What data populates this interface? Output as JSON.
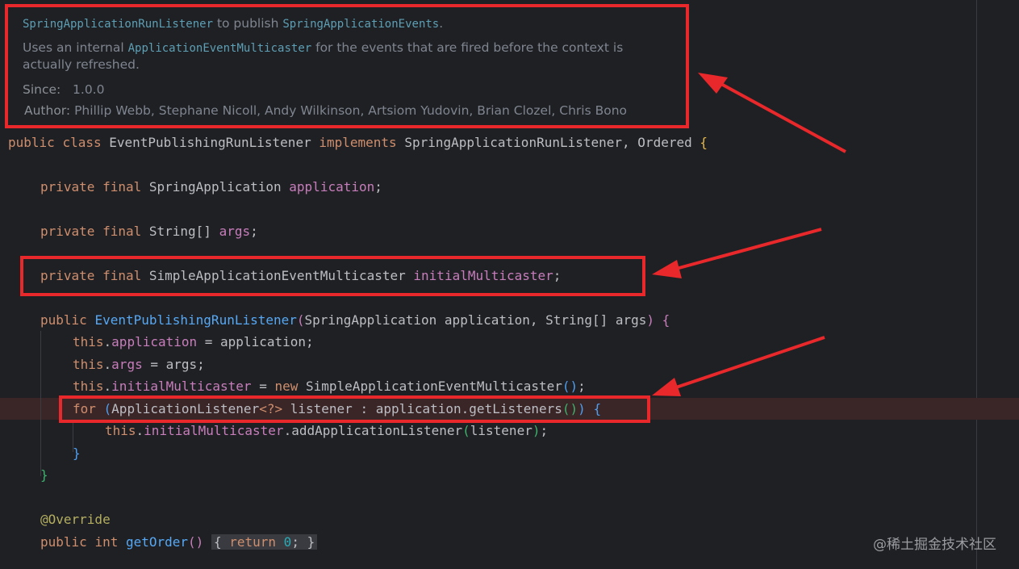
{
  "javadoc": {
    "line1": {
      "class_name": "SpringApplicationRunListener",
      "middle": " to publish ",
      "events": "SpringApplicationEvents",
      "end": "."
    },
    "line2": {
      "start": "Uses an internal ",
      "multicaster": "ApplicationEventMulticaster",
      "end": " for the events that are fired before the context is"
    },
    "line3": "actually refreshed.",
    "since_label": "Since:",
    "since_value": "1.0.0",
    "author_label": "Author:",
    "author_value": "Phillip Webb, Stephane Nicoll, Andy Wilkinson, Artsiom Yudovin, Brian Clozel, Chris Bono"
  },
  "code": {
    "class_decl": {
      "public": "public",
      "class": "class",
      "name": "EventPublishingRunListener",
      "implements": "implements",
      "iface": "SpringApplicationRunListener, Ordered",
      "brace": "{"
    },
    "field1": {
      "mods": "private final",
      "type": "SpringApplication",
      "name": "application",
      "semi": ";"
    },
    "field2": {
      "mods": "private final",
      "type": "String[]",
      "name": "args",
      "semi": ";"
    },
    "field3": {
      "mods": "private final",
      "type": "SimpleApplicationEventMulticaster",
      "name": "initialMulticaster",
      "semi": ";"
    },
    "ctor": {
      "public": "public",
      "name": "EventPublishingRunListener",
      "open": "(",
      "params": "SpringApplication application, String[] args",
      "close": ")",
      "brace": "{"
    },
    "stmt1": {
      "this": "this",
      "dot": ".",
      "field": "application",
      "rest": " = application;"
    },
    "stmt2": {
      "this": "this",
      "dot": ".",
      "field": "args",
      "rest": " = args;"
    },
    "stmt3": {
      "this": "this",
      "dot": ".",
      "field": "initialMulticaster",
      "eq": " = ",
      "new": "new",
      "type": " SimpleApplicationEventMulticaster",
      "parens": "()",
      "semi": ";"
    },
    "for_loop": {
      "for": "for",
      "open": " (",
      "type": "ApplicationListener",
      "gen": "<?>",
      "mid": " listener : application.getListeners",
      "inner": "()",
      "close": ")",
      "brace": "{"
    },
    "loop_body": {
      "this": "this",
      "dot": ".",
      "field": "initialMulticaster",
      "call": ".addApplicationListener",
      "open": "(",
      "arg": "listener",
      "close": ")",
      "semi": ";"
    },
    "close_inner": "}",
    "close_ctor": "}",
    "annotation": "@Override",
    "getorder": {
      "public": "public",
      "int": "int",
      "name": "getOrder",
      "parens": "()",
      "ob": "{",
      "return": "return",
      "zero": "0",
      "semi": ";",
      "cb": "}"
    }
  },
  "watermark": "@稀土掘金技术社区"
}
